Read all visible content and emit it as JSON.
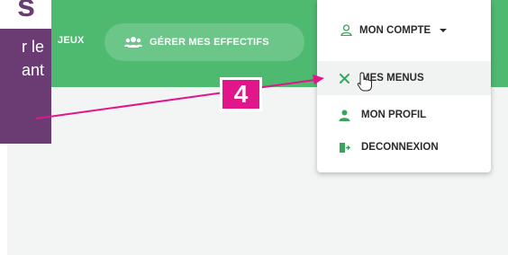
{
  "nav": {
    "jeux_label": "JEUX",
    "effectifs_label": "GÉRER MES EFFECTIFS"
  },
  "callout": {
    "big_letter": "s",
    "line1": "r le",
    "line2": "ant"
  },
  "account_menu": {
    "title": "MON COMPTE",
    "items": [
      {
        "label": "MES MENUS",
        "icon": "utensils-icon",
        "active": true
      },
      {
        "label": "MON PROFIL",
        "icon": "user-icon"
      },
      {
        "label": "DECONNEXION",
        "icon": "logout-icon"
      }
    ]
  },
  "annotation": {
    "step_number": "4"
  },
  "colors": {
    "nav_green": "#4dba70",
    "pill_green": "#6cc68a",
    "icon_green": "#3aa35c",
    "callout_purple": "#6b3b74",
    "badge_pink": "#e1168a",
    "content_bg": "#f3f4f4"
  }
}
